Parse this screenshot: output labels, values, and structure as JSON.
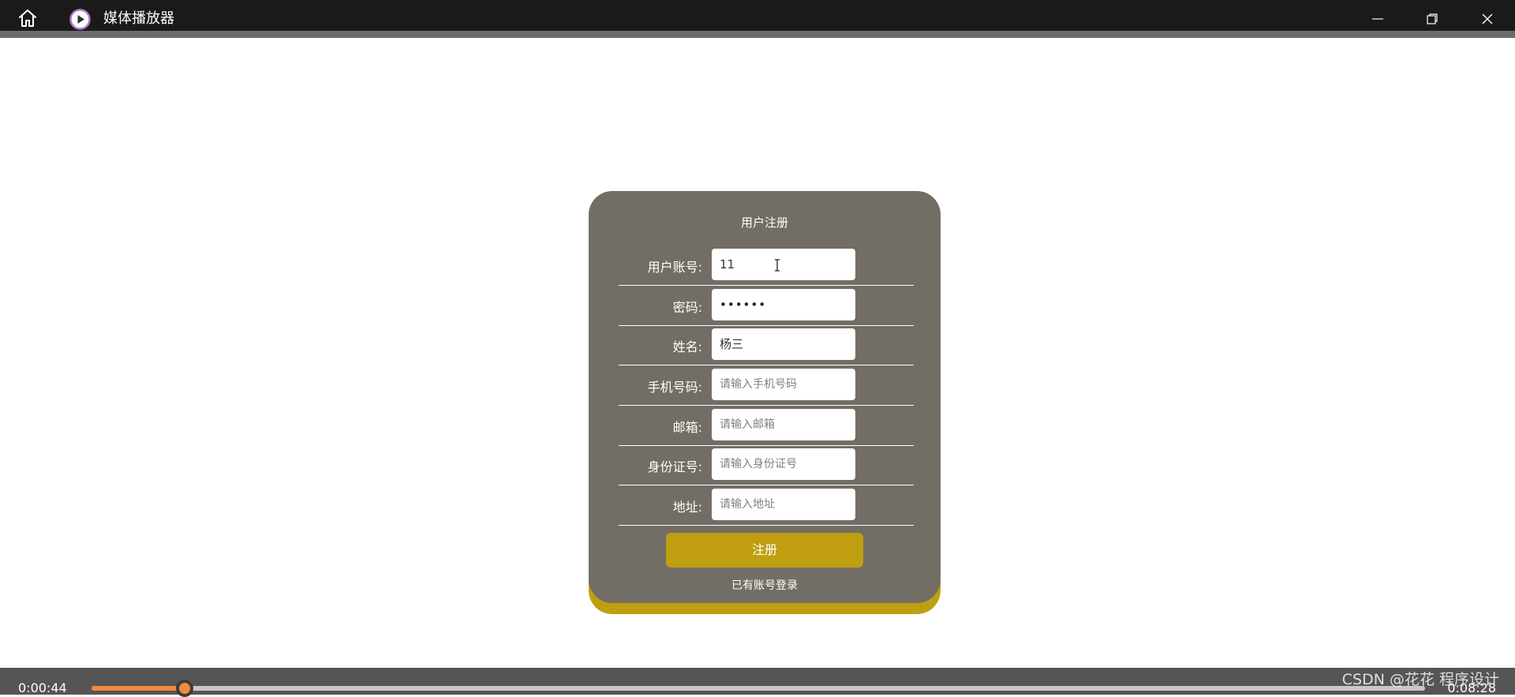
{
  "window": {
    "title": "媒体播放器",
    "icons": {
      "home": "home-icon",
      "app": "play-circle-icon",
      "minimize": "minimize-icon",
      "maximize": "restore-icon",
      "close": "close-icon"
    }
  },
  "form": {
    "title": "用户注册",
    "fields": [
      {
        "label": "用户账号:",
        "value": "11",
        "placeholder": ""
      },
      {
        "label": "密码:",
        "value": "••••••",
        "placeholder": ""
      },
      {
        "label": "姓名:",
        "value": "杨三",
        "placeholder": ""
      },
      {
        "label": "手机号码:",
        "value": "",
        "placeholder": "请输入手机号码"
      },
      {
        "label": "邮箱:",
        "value": "",
        "placeholder": "请输入邮箱"
      },
      {
        "label": "身份证号:",
        "value": "",
        "placeholder": "请输入身份证号"
      },
      {
        "label": "地址:",
        "value": "",
        "placeholder": "请输入地址"
      }
    ],
    "submit_label": "注册",
    "login_link": "已有账号登录"
  },
  "player": {
    "current_time": "0:00:44",
    "total_time": "0:08:28",
    "progress": 0.07
  },
  "watermark": "CSDN @花花 程序设计",
  "colors": {
    "titlebar": "#1a1a1a",
    "card": "#726e66",
    "accent": "#bf9f10",
    "progress": "#f28a3a",
    "bottombar": "#555555"
  }
}
